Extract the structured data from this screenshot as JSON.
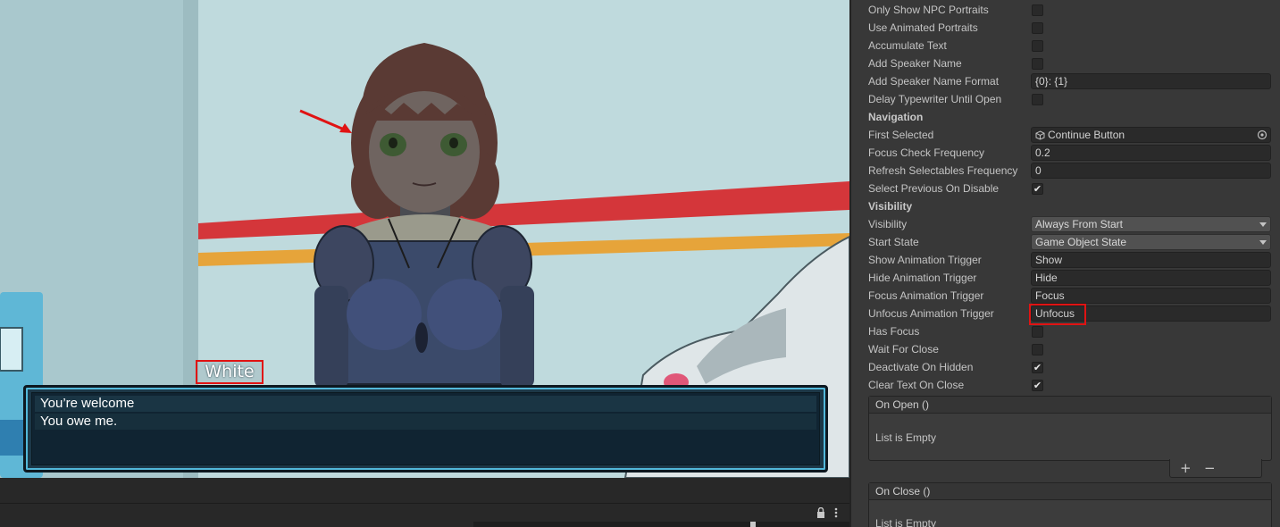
{
  "game_view": {
    "speaker_name": "White",
    "responses": [
      "You’re welcome",
      "You owe me."
    ]
  },
  "inspector": {
    "rows": [
      {
        "label": "Only Show NPC Portraits",
        "kind": "checkbox",
        "checked": false
      },
      {
        "label": "Use Animated Portraits",
        "kind": "checkbox",
        "checked": false
      },
      {
        "label": "Accumulate Text",
        "kind": "checkbox",
        "checked": false
      },
      {
        "label": "Add Speaker Name",
        "kind": "checkbox",
        "checked": false
      },
      {
        "label": "Add Speaker Name Format",
        "kind": "text",
        "value": "{0}: {1}"
      },
      {
        "label": "Delay Typewriter Until Open",
        "kind": "checkbox",
        "checked": false
      },
      {
        "label": "Navigation",
        "kind": "section"
      },
      {
        "label": "First Selected",
        "kind": "object",
        "value": "Continue Button"
      },
      {
        "label": "Focus Check Frequency",
        "kind": "text",
        "value": "0.2"
      },
      {
        "label": "Refresh Selectables Frequency",
        "kind": "text",
        "value": "0"
      },
      {
        "label": "Select Previous On Disable",
        "kind": "checkbox",
        "checked": true
      },
      {
        "label": "Visibility",
        "kind": "section"
      },
      {
        "label": "Visibility",
        "kind": "dropdown",
        "value": "Always From Start"
      },
      {
        "label": "Start State",
        "kind": "dropdown",
        "value": "Game Object State"
      },
      {
        "label": "Show Animation Trigger",
        "kind": "text",
        "value": "Show"
      },
      {
        "label": "Hide Animation Trigger",
        "kind": "text",
        "value": "Hide"
      },
      {
        "label": "Focus Animation Trigger",
        "kind": "text",
        "value": "Focus"
      },
      {
        "label": "Unfocus Animation Trigger",
        "kind": "text",
        "value": "Unfocus"
      },
      {
        "label": "Has Focus",
        "kind": "checkbox",
        "checked": false
      },
      {
        "label": "Wait For Close",
        "kind": "checkbox",
        "checked": false
      },
      {
        "label": "Deactivate On Hidden",
        "kind": "checkbox",
        "checked": true
      },
      {
        "label": "Clear Text On Close",
        "kind": "checkbox",
        "checked": true
      }
    ],
    "on_open": {
      "title": "On Open ()",
      "empty_text": "List is Empty"
    },
    "on_close": {
      "title": "On Close ()",
      "empty_text": "List is Empty"
    },
    "add_label": "+",
    "remove_label": "−",
    "checkmark": "✔"
  },
  "colors": {
    "highlight": "#e01313",
    "panel_border": "#52b8da",
    "panel_fill": "#102432",
    "inspector_bg": "#383838"
  }
}
